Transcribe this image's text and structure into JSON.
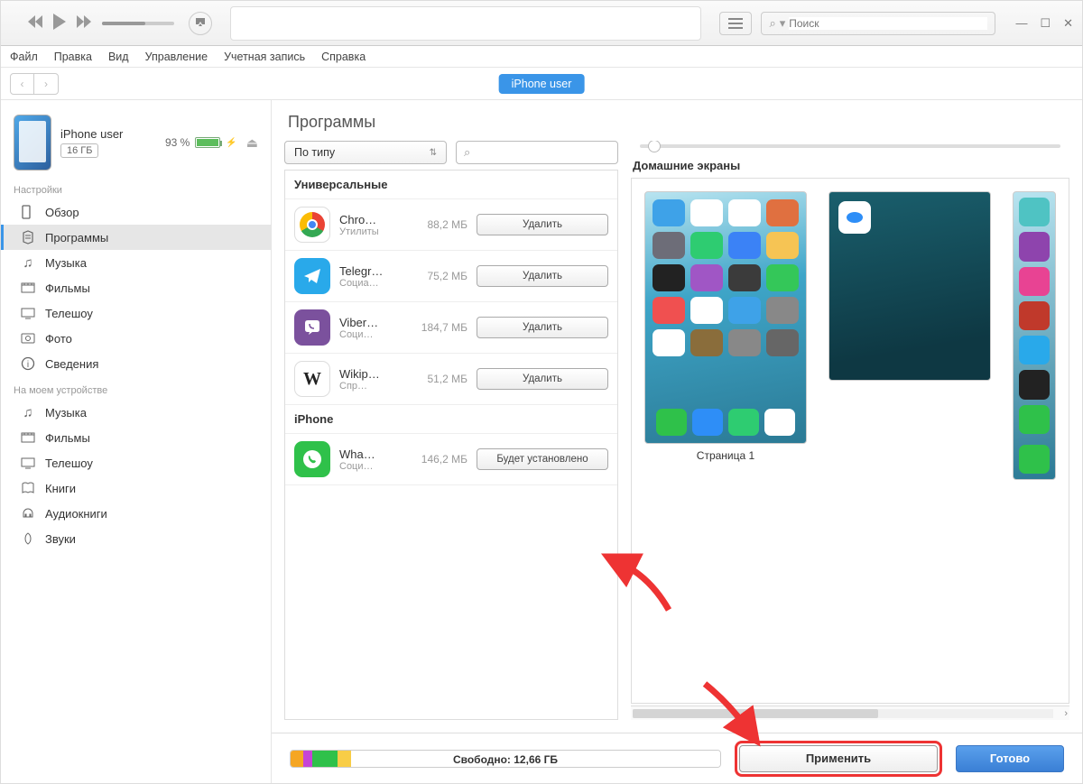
{
  "titlebar": {
    "search_placeholder": "Поиск",
    "minimize": "—",
    "maximize": "☐",
    "close": "✕"
  },
  "menu": {
    "items": [
      "Файл",
      "Правка",
      "Вид",
      "Управление",
      "Учетная запись",
      "Справка"
    ]
  },
  "tabbar": {
    "device_tab": "iPhone user"
  },
  "device": {
    "name": "iPhone user",
    "capacity": "16 ГБ",
    "battery_pct": "93 %"
  },
  "sidebar": {
    "settings_label": "Настройки",
    "settings_items": [
      {
        "icon": "summary",
        "label": "Обзор"
      },
      {
        "icon": "apps",
        "label": "Программы"
      },
      {
        "icon": "music",
        "label": "Музыка"
      },
      {
        "icon": "movies",
        "label": "Фильмы"
      },
      {
        "icon": "tv",
        "label": "Телешоу"
      },
      {
        "icon": "photo",
        "label": "Фото"
      },
      {
        "icon": "info",
        "label": "Сведения"
      }
    ],
    "device_label": "На моем устройстве",
    "device_items": [
      {
        "icon": "music",
        "label": "Музыка"
      },
      {
        "icon": "movies",
        "label": "Фильмы"
      },
      {
        "icon": "tv",
        "label": "Телешоу"
      },
      {
        "icon": "books",
        "label": "Книги"
      },
      {
        "icon": "audiobooks",
        "label": "Аудиокниги"
      },
      {
        "icon": "tones",
        "label": "Звуки"
      }
    ]
  },
  "main": {
    "title": "Программы",
    "sort_label": "По типу",
    "groups": [
      {
        "title": "Универсальные",
        "apps": [
          {
            "name": "Chro…",
            "cat": "Утилиты",
            "size": "88,2 МБ",
            "action": "Удалить",
            "icon": "chrome"
          },
          {
            "name": "Telegr…",
            "cat": "Социа…",
            "size": "75,2 МБ",
            "action": "Удалить",
            "icon": "telegram"
          },
          {
            "name": "Viber…",
            "cat": "Соци…",
            "size": "184,7 МБ",
            "action": "Удалить",
            "icon": "viber"
          },
          {
            "name": "Wikip…",
            "cat": "Спр…",
            "size": "51,2 МБ",
            "action": "Удалить",
            "icon": "wiki"
          }
        ]
      },
      {
        "title": "iPhone",
        "apps": [
          {
            "name": "Wha…",
            "cat": "Соци…",
            "size": "146,2 МБ",
            "action": "Будет установлено",
            "icon": "whatsapp"
          }
        ]
      }
    ],
    "screens_label": "Домашние экраны",
    "page1_caption": "Страница 1"
  },
  "footer": {
    "free_label": "Свободно: 12,66 ГБ",
    "apply": "Применить",
    "done": "Готово"
  },
  "home_icons_colors": {
    "row1": [
      "#3ea2e8",
      "#fff",
      "#fff",
      "#e07040"
    ],
    "row2": [
      "#6d6d78",
      "#2ecc71",
      "#3b82f6",
      "#f6c454"
    ],
    "row3": [
      "#222",
      "#a056c5",
      "#3b3b3b",
      "#34c759"
    ],
    "row4": [
      "#f05050",
      "#fff",
      "#3ea2e8",
      "#888"
    ],
    "row5": [
      "#fff",
      "#8a6d3b",
      "#888",
      "#666"
    ],
    "dock": [
      "#2fc14a",
      "#2e8ef7",
      "#2ecc71",
      "#fff"
    ]
  },
  "partial_icons": [
    "#4fc3c3",
    "#8e44ad",
    "#e84393",
    "#c0392b",
    "#29a9ea",
    "#222",
    "#2fc14a"
  ]
}
